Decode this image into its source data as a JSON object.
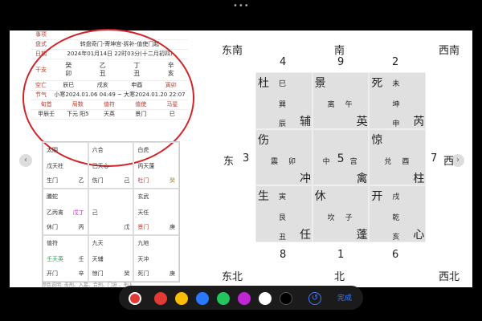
{
  "info": {
    "rows": [
      {
        "k": "事项",
        "v": ""
      },
      {
        "k": "盘式",
        "v": "转盘奇门-寄坤宫-拆补-值使门起"
      },
      {
        "k": "日期",
        "v": "2024年01月14日 22时03分(十二月初四)"
      }
    ],
    "pillars_label": "干支",
    "pillars": [
      {
        "top": "癸",
        "bottom": "卯"
      },
      {
        "top": "乙",
        "bottom": "丑"
      },
      {
        "top": "丁",
        "bottom": "丑"
      },
      {
        "top": "辛",
        "bottom": "亥"
      }
    ],
    "kong": {
      "k": "空亡",
      "cells": [
        "辰巳",
        "戌亥",
        "申酉",
        "寅卯"
      ]
    },
    "jieqi": {
      "k": "节气",
      "v": "小寒2024.01.06 04:49 ~ 大寒2024.01.20 22:07"
    },
    "last": {
      "cells": [
        "旬首",
        "局数",
        "值符",
        "值使",
        "马星"
      ]
    },
    "lastv": {
      "cells": [
        "甲辰壬",
        "下元 阳5",
        "天英",
        "景门",
        "巳"
      ]
    }
  },
  "lgrid": [
    {
      "t": "太阴",
      "m": "戊天柱",
      "b": "生门",
      "r1": "",
      "r2": "乙"
    },
    {
      "t": "六合",
      "m": "己天心",
      "b": "伤门",
      "r1": "",
      "r2": "己"
    },
    {
      "t": "白虎",
      "m": "丙天蓬",
      "b": "杜门",
      "r1": "",
      "r2": "癸"
    },
    {
      "t": "螣蛇",
      "m": "乙丙禽",
      "b": "休门",
      "r1": "戊丁",
      "r2": "丙"
    },
    {
      "t": "",
      "m": "己",
      "b": "",
      "r1": "",
      "r2": "戊"
    },
    {
      "t": "玄武",
      "m": "天任",
      "b": "景门",
      "r1": "",
      "r2": "庚"
    },
    {
      "t": "值符",
      "m": "壬天英",
      "b": "开门",
      "r1": "壬",
      "r2": "辛"
    },
    {
      "t": "九天",
      "m": "天辅",
      "b": "惊门",
      "r1": "",
      "r2": "癸"
    },
    {
      "t": "九地",
      "m": "天冲",
      "b": "死门",
      "r1": "",
      "r2": "庚"
    }
  ],
  "legend": "颜色说明: 击刑、入墓、合刑、门迫 、刑入",
  "dirs": {
    "se": "东南",
    "s": "南",
    "sw": "西南",
    "e": "东",
    "w": "西",
    "ne": "东北",
    "n": "北",
    "nw": "西北"
  },
  "nums": {
    "top": [
      "4",
      "9",
      "2"
    ],
    "mid_left": "3",
    "mid_right": "7",
    "bottom": [
      "8",
      "1",
      "6"
    ]
  },
  "rgrid": [
    {
      "a": "杜",
      "b": "巳",
      "c": "巽",
      "d": "辰",
      "e": "辅"
    },
    {
      "a": "景",
      "b": "离",
      "c": "午",
      "d": "",
      "e": "英"
    },
    {
      "a": "死",
      "b": "未",
      "c": "坤",
      "d": "申",
      "e": "芮"
    },
    {
      "a": "伤",
      "b": "震",
      "c": "卯",
      "d": "",
      "e": "冲"
    },
    {
      "a": "中",
      "b": "5",
      "c": "宫",
      "d": "",
      "e": "禽"
    },
    {
      "a": "惊",
      "b": "兑",
      "c": "酉",
      "d": "",
      "e": "柱"
    },
    {
      "a": "生",
      "b": "寅",
      "c": "艮",
      "d": "丑",
      "e": "任"
    },
    {
      "a": "休",
      "b": "坎",
      "c": "子",
      "d": "",
      "e": "蓬"
    },
    {
      "a": "开",
      "b": "戌",
      "c": "乾",
      "d": "亥",
      "e": "心"
    }
  ],
  "toolbar": {
    "done": "完成"
  },
  "colors": {
    "circle": "#d0262a",
    "toolbar": [
      "#e53935",
      "#fbbc04",
      "#2979ff",
      "#22c55e",
      "#c026d3",
      "#ffffff",
      "#000000"
    ]
  }
}
